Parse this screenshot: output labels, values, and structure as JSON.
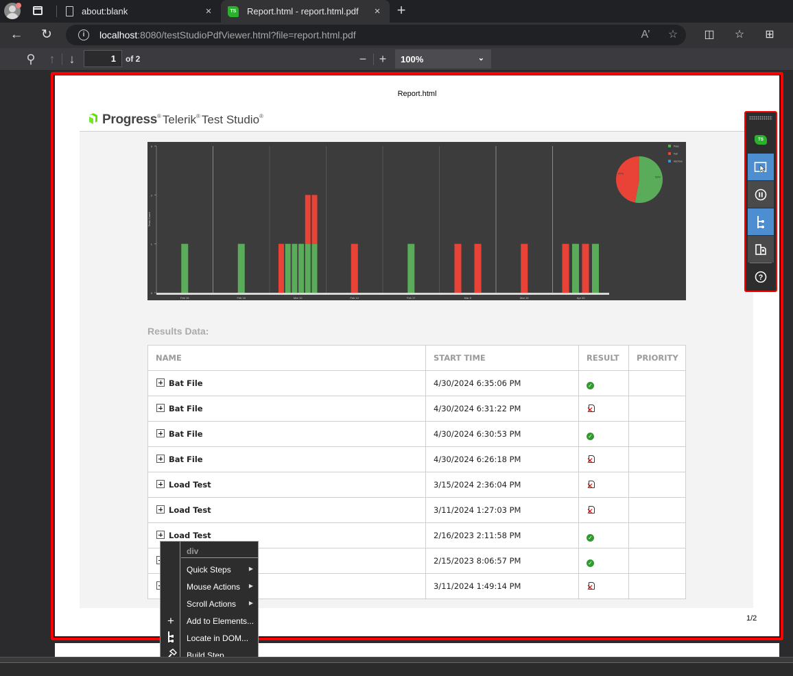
{
  "browser": {
    "tabs": [
      {
        "title": "about:blank",
        "icon": "page-icon",
        "active": false
      },
      {
        "title": "Report.html - report.html.pdf",
        "icon": "test-studio-favicon",
        "active": true
      }
    ],
    "new_tab_icon": "+",
    "close_icon": "×",
    "address": {
      "host": "localhost",
      "rest": ":8080/testStudioPdfViewer.html?file=report.html.pdf"
    }
  },
  "pdf_toolbar": {
    "current_page": "1",
    "of_pages": "of 2",
    "zoom": "100%"
  },
  "page": {
    "header": "Report.html",
    "logo": {
      "progress": "Progress",
      "telerik": "Telerik",
      "test_studio": "Test Studio"
    },
    "page_number": "1/2",
    "results_title": "Results Data:",
    "table": {
      "columns": [
        "NAME",
        "START TIME",
        "RESULT",
        "PRIORITY"
      ],
      "rows": [
        {
          "name": "Bat File",
          "start_time": "4/30/2024 6:35:06 PM",
          "result": "pass",
          "priority": ""
        },
        {
          "name": "Bat File",
          "start_time": "4/30/2024 6:31:22 PM",
          "result": "fail",
          "priority": ""
        },
        {
          "name": "Bat File",
          "start_time": "4/30/2024 6:30:53 PM",
          "result": "pass",
          "priority": ""
        },
        {
          "name": "Bat File",
          "start_time": "4/30/2024 6:26:18 PM",
          "result": "fail",
          "priority": ""
        },
        {
          "name": "Load Test",
          "start_time": "3/15/2024 2:36:04 PM",
          "result": "fail",
          "priority": ""
        },
        {
          "name": "Load Test",
          "start_time": "3/11/2024 1:27:03 PM",
          "result": "fail",
          "priority": ""
        },
        {
          "name": "Load Test",
          "start_time": "2/16/2023 2:11:58 PM",
          "result": "pass",
          "priority": ""
        },
        {
          "name": "",
          "start_time": "2/15/2023 8:06:57 PM",
          "result": "pass",
          "priority": ""
        },
        {
          "name": "",
          "start_time": "3/11/2024 1:49:14 PM",
          "result": "fail",
          "priority": ""
        }
      ]
    }
  },
  "colors": {
    "pass": "#5aab5a",
    "fail": "#e84336",
    "not_run": "#3d8fe0",
    "chart_bg": "#3c3c3c",
    "highlight": "#ff0000",
    "ts_blue": "#4d8ed0"
  },
  "chart_data": [
    {
      "type": "bar",
      "stacked": true,
      "title": "",
      "xlabel": "",
      "ylabel": "Tests Count",
      "ylim": [
        0,
        3
      ],
      "yticks": [
        "0",
        "1",
        "2",
        "3"
      ],
      "categories": [
        "Feb 15",
        "Feb 16",
        "Mar 10",
        "Feb 12",
        "Feb 17",
        "Mar 8",
        "Mar 15",
        "Apr 30"
      ],
      "groups": [
        [
          {
            "pass": 1,
            "fail": 0
          }
        ],
        [
          {
            "pass": 1,
            "fail": 0
          }
        ],
        [
          {
            "pass": 0,
            "fail": 1
          },
          {
            "pass": 1,
            "fail": 0
          },
          {
            "pass": 1,
            "fail": 0
          },
          {
            "pass": 1,
            "fail": 0
          },
          {
            "pass": 1,
            "fail": 1
          },
          {
            "pass": 1,
            "fail": 1
          }
        ],
        [
          {
            "pass": 0,
            "fail": 1
          }
        ],
        [
          {
            "pass": 1,
            "fail": 0
          }
        ],
        [
          {
            "pass": 0,
            "fail": 1
          },
          {
            "pass": 0,
            "fail": 1
          }
        ],
        [
          {
            "pass": 0,
            "fail": 1
          }
        ],
        [
          {
            "pass": 0,
            "fail": 1
          },
          {
            "pass": 1,
            "fail": 0
          },
          {
            "pass": 0,
            "fail": 1
          },
          {
            "pass": 1,
            "fail": 0
          }
        ]
      ],
      "series": [
        {
          "name": "Pass",
          "color": "#5aab5a"
        },
        {
          "name": "Fail",
          "color": "#e84336"
        }
      ],
      "grid": true
    },
    {
      "type": "pie",
      "legend": [
        "Pass",
        "Fail",
        "Not Run"
      ],
      "legend_position": "top-right",
      "slices": [
        {
          "label": "Pass",
          "value": 53,
          "text": "53%",
          "color": "#5aab5a"
        },
        {
          "label": "Fail",
          "value": 47,
          "text": "47%",
          "color": "#e84336"
        },
        {
          "label": "Not Run",
          "value": 0,
          "text": "",
          "color": "#3d8fe0"
        }
      ]
    }
  ],
  "context_menu": {
    "header": "div",
    "items": [
      {
        "label": "Quick Steps",
        "submenu": true,
        "icon": ""
      },
      {
        "label": "Mouse Actions",
        "submenu": true,
        "icon": ""
      },
      {
        "label": "Scroll Actions",
        "submenu": true,
        "icon": ""
      },
      {
        "label": "Add to Elements...",
        "submenu": false,
        "icon": "plus-icon"
      },
      {
        "label": "Locate in DOM...",
        "submenu": false,
        "icon": "dom-tree-icon"
      },
      {
        "label": "Build Step...",
        "submenu": false,
        "icon": "hammer-icon"
      }
    ],
    "submenu_arrow": "▶"
  },
  "ts_toolbar": {
    "logo": "TS",
    "buttons": [
      "highlight-elements",
      "pause-recording",
      "dom-explorer",
      "docked-mode",
      "help"
    ]
  }
}
